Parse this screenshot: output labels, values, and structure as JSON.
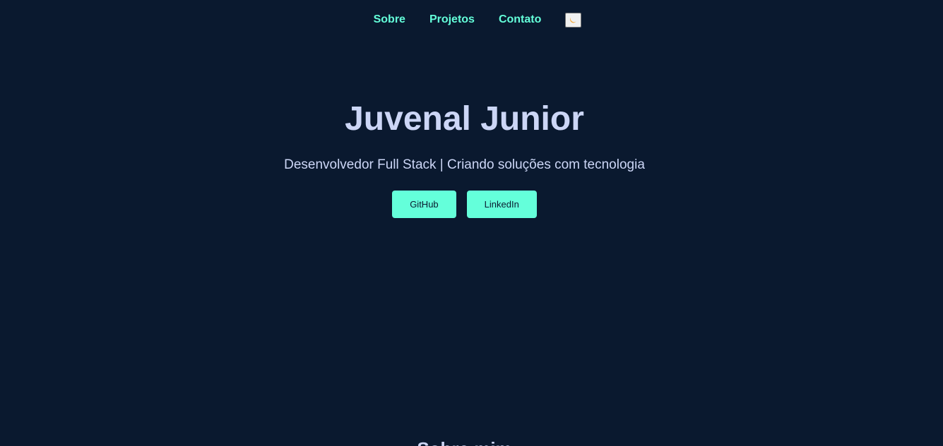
{
  "nav": {
    "items": [
      {
        "label": "Sobre"
      },
      {
        "label": "Projetos"
      },
      {
        "label": "Contato"
      }
    ],
    "theme_toggle_icon": "moon-icon"
  },
  "hero": {
    "name": "Juvenal Junior",
    "tagline": "Desenvolvedor Full Stack | Criando soluções com tecnologia",
    "buttons": [
      {
        "label": "GitHub"
      },
      {
        "label": "LinkedIn"
      }
    ]
  },
  "about": {
    "title": "Sobre mim"
  },
  "colors": {
    "background": "#0a192f",
    "accent": "#64ffda",
    "text": "#ccd6f6"
  }
}
